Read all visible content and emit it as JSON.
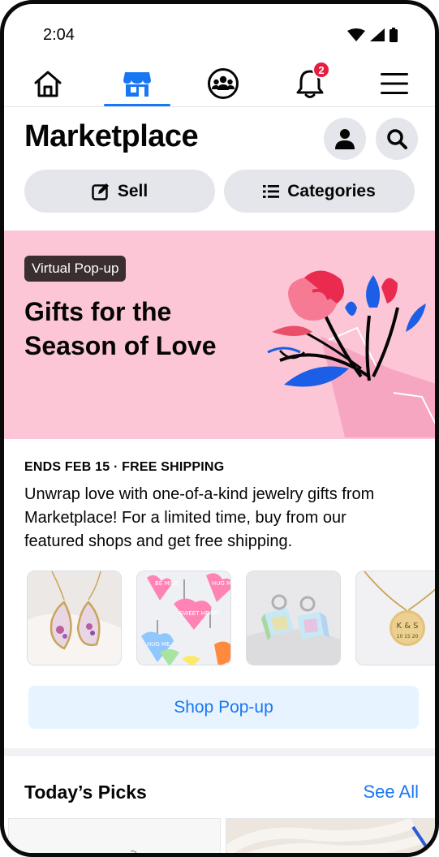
{
  "status": {
    "time": "2:04"
  },
  "nav": {
    "items": [
      {
        "name": "home",
        "icon": "home-icon"
      },
      {
        "name": "marketplace",
        "icon": "marketplace-icon",
        "active": true
      },
      {
        "name": "groups",
        "icon": "groups-icon"
      },
      {
        "name": "notifications",
        "icon": "bell-icon",
        "badge": "2"
      },
      {
        "name": "menu",
        "icon": "menu-icon"
      }
    ]
  },
  "header": {
    "title": "Marketplace"
  },
  "actions": {
    "sell_label": "Sell",
    "categories_label": "Categories"
  },
  "banner": {
    "tag": "Virtual Pop-up",
    "title": "Gifts for the Season of Love"
  },
  "info": {
    "meta": "ENDS FEB 15 · FREE SHIPPING",
    "description": "Unwrap love with one-of-a-kind jewelry gifts from Marketplace! For a limited time, buy from our featured shops and get free shipping."
  },
  "thumbs": {
    "candy_hearts": [
      "BE MINE",
      "HUG ME",
      "SWEET HEART",
      "HUG ME"
    ],
    "necklace_engraving": "K & S",
    "necklace_date": "10 15 20"
  },
  "shop_button": "Shop Pop-up",
  "picks": {
    "title": "Today’s Picks",
    "see_all": "See All"
  },
  "colors": {
    "accent": "#1877f2",
    "banner_bg": "#fcc6d6",
    "badge": "#e41e3f"
  }
}
